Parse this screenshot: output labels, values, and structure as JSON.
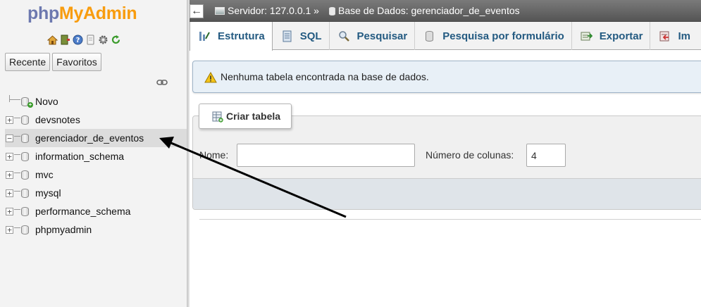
{
  "sidebar": {
    "logo_part1": "php",
    "logo_part2": "MyAdmin",
    "tabs": [
      {
        "label": "Recente"
      },
      {
        "label": "Favoritos"
      }
    ],
    "tree": [
      {
        "label": "Novo"
      },
      {
        "label": "devsnotes"
      },
      {
        "label": "gerenciador_de_eventos",
        "selected": true
      },
      {
        "label": "information_schema"
      },
      {
        "label": "mvc"
      },
      {
        "label": "mysql"
      },
      {
        "label": "performance_schema"
      },
      {
        "label": "phpmyadmin"
      }
    ],
    "nav_icons": [
      "home-icon",
      "exit-icon",
      "help-icon",
      "docs-icon",
      "gear-icon",
      "reload-icon"
    ]
  },
  "topbar": {
    "back_glyph": "←",
    "server": "Servidor: 127.0.0.1 »",
    "database": "Base de Dados: gerenciador_de_eventos"
  },
  "tabs": [
    {
      "label": "Estrutura",
      "icon": "structure-icon",
      "active": true
    },
    {
      "label": "SQL",
      "icon": "sql-icon"
    },
    {
      "label": "Pesquisar",
      "icon": "search-icon"
    },
    {
      "label": "Pesquisa por formulário",
      "icon": "query-icon"
    },
    {
      "label": "Exportar",
      "icon": "export-icon"
    },
    {
      "label": "Im",
      "icon": "import-icon"
    }
  ],
  "notice": {
    "message": "Nenhuma tabela encontrada na base de dados."
  },
  "create_table": {
    "legend": "Criar tabela",
    "name_label": "Nome:",
    "name_value": "",
    "columns_label": "Número de colunas:",
    "columns_value": "4"
  },
  "colors": {
    "logo_blue": "#6c78af",
    "logo_orange": "#f89c0e",
    "tab_text": "#235a81",
    "notice_bg": "#e8f0f7"
  }
}
